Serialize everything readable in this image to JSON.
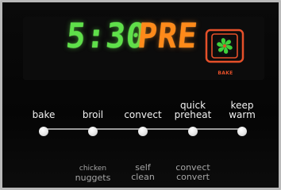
{
  "display": {
    "time": "5:30",
    "mode": "PRE",
    "oven_icon": "convection-fan-icon",
    "oven_caption": "BAKE",
    "colors": {
      "time": "#5fe04a",
      "mode": "#ff8a1a",
      "icon": "#e5502a",
      "fan": "#3fd13a"
    }
  },
  "buttons": [
    {
      "line1": "",
      "line2": "bake"
    },
    {
      "line1": "",
      "line2": "broil"
    },
    {
      "line1": "",
      "line2": "convect"
    },
    {
      "line1": "quick",
      "line2": "preheat"
    },
    {
      "line1": "keep",
      "line2": "warm"
    }
  ],
  "secondary_labels": [
    {
      "line1": "chicken",
      "line2": "nuggets"
    },
    {
      "line1": "self",
      "line2": "clean"
    },
    {
      "line1": "convect",
      "line2": "convert"
    }
  ]
}
